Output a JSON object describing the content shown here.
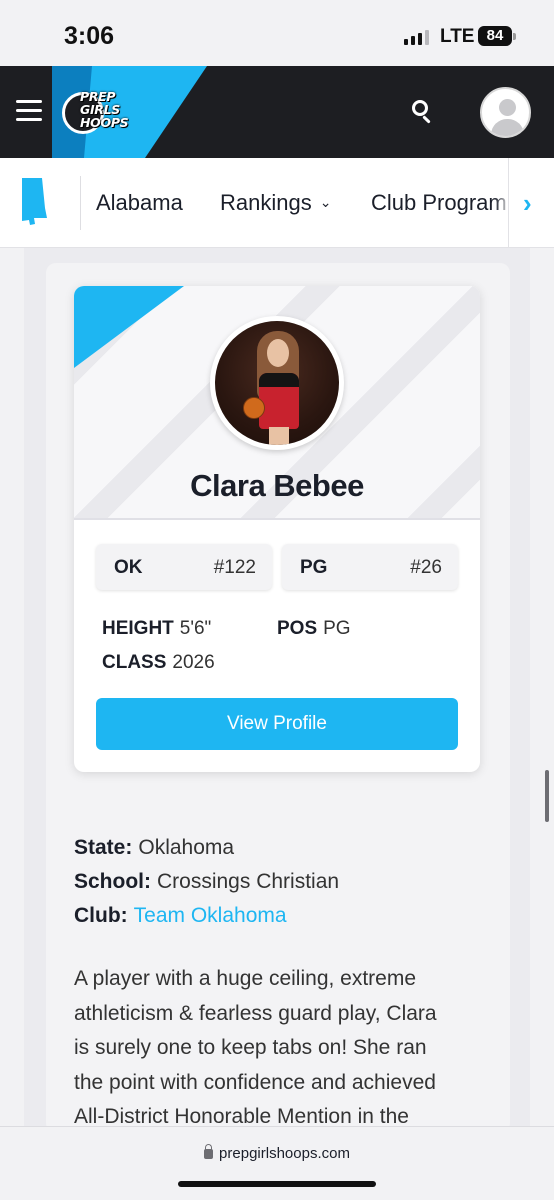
{
  "status_bar": {
    "time": "3:06",
    "network": "LTE",
    "battery": "84"
  },
  "header": {
    "logo_lines": [
      "PREP",
      "GIRLS",
      "HOOPS"
    ]
  },
  "state_nav": {
    "items": [
      {
        "label": "Alabama"
      },
      {
        "label": "Rankings"
      },
      {
        "label": "Club Program"
      }
    ]
  },
  "player_card": {
    "name": "Clara Bebee",
    "state_rank": {
      "label": "OK",
      "value": "#122"
    },
    "position_rank": {
      "label": "PG",
      "value": "#26"
    },
    "height": {
      "label": "HEIGHT",
      "value": "5'6\""
    },
    "pos": {
      "label": "POS",
      "value": "PG"
    },
    "class": {
      "label": "CLASS",
      "value": "2026"
    },
    "button_label": "View Profile"
  },
  "details": {
    "state": {
      "label": "State:",
      "value": "Oklahoma"
    },
    "school": {
      "label": "School:",
      "value": "Crossings Christian"
    },
    "club": {
      "label": "Club:",
      "value": "Team Oklahoma"
    }
  },
  "bio_lines": [
    "A player with a huge ceiling, extreme",
    "athleticism & fearless guard play, Clara",
    "is surely one to keep tabs on! She ran",
    "the point with confidence and achieved",
    "All-District Honorable Mention in the"
  ],
  "url_bar": {
    "domain": "prepgirlshoops.com"
  },
  "colors": {
    "accent": "#1eb6f2",
    "header_bg": "#1d1e22"
  }
}
